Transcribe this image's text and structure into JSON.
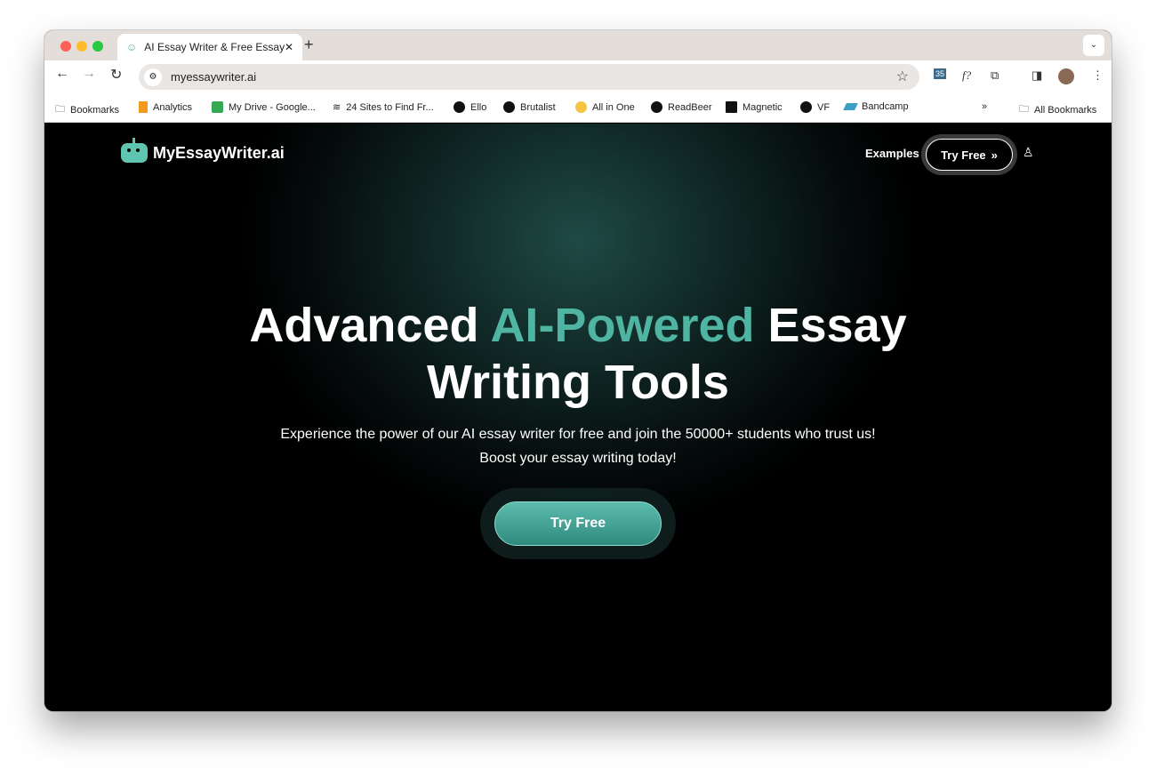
{
  "browser": {
    "tab_title": "AI Essay Writer & Free Essay",
    "url": "myessaywriter.ai",
    "bookmarks": [
      "Bookmarks",
      "Analytics",
      "My Drive - Google...",
      "24 Sites to Find Fr...",
      "Ello",
      "Brutalist",
      "All in One",
      "ReadBeer",
      "Magnetic",
      "VF",
      "Bandcamp"
    ],
    "all_bookmarks": "All Bookmarks",
    "ext_badge": "35",
    "ext_f": "f?"
  },
  "site": {
    "logo": "MyEssayWriter.ai",
    "nav_examples": "Examples",
    "nav_try_free": "Try Free",
    "headline_1": "Advanced ",
    "headline_accent": "AI-Powered",
    "headline_2": " Essay",
    "headline_3": "Writing Tools",
    "subtitle_1": "Experience the power of our AI essay writer for free and join the 50000+ students who trust us!",
    "subtitle_2": "Boost your essay writing today!",
    "cta": "Try Free",
    "accent_color": "#4fb5a2"
  }
}
